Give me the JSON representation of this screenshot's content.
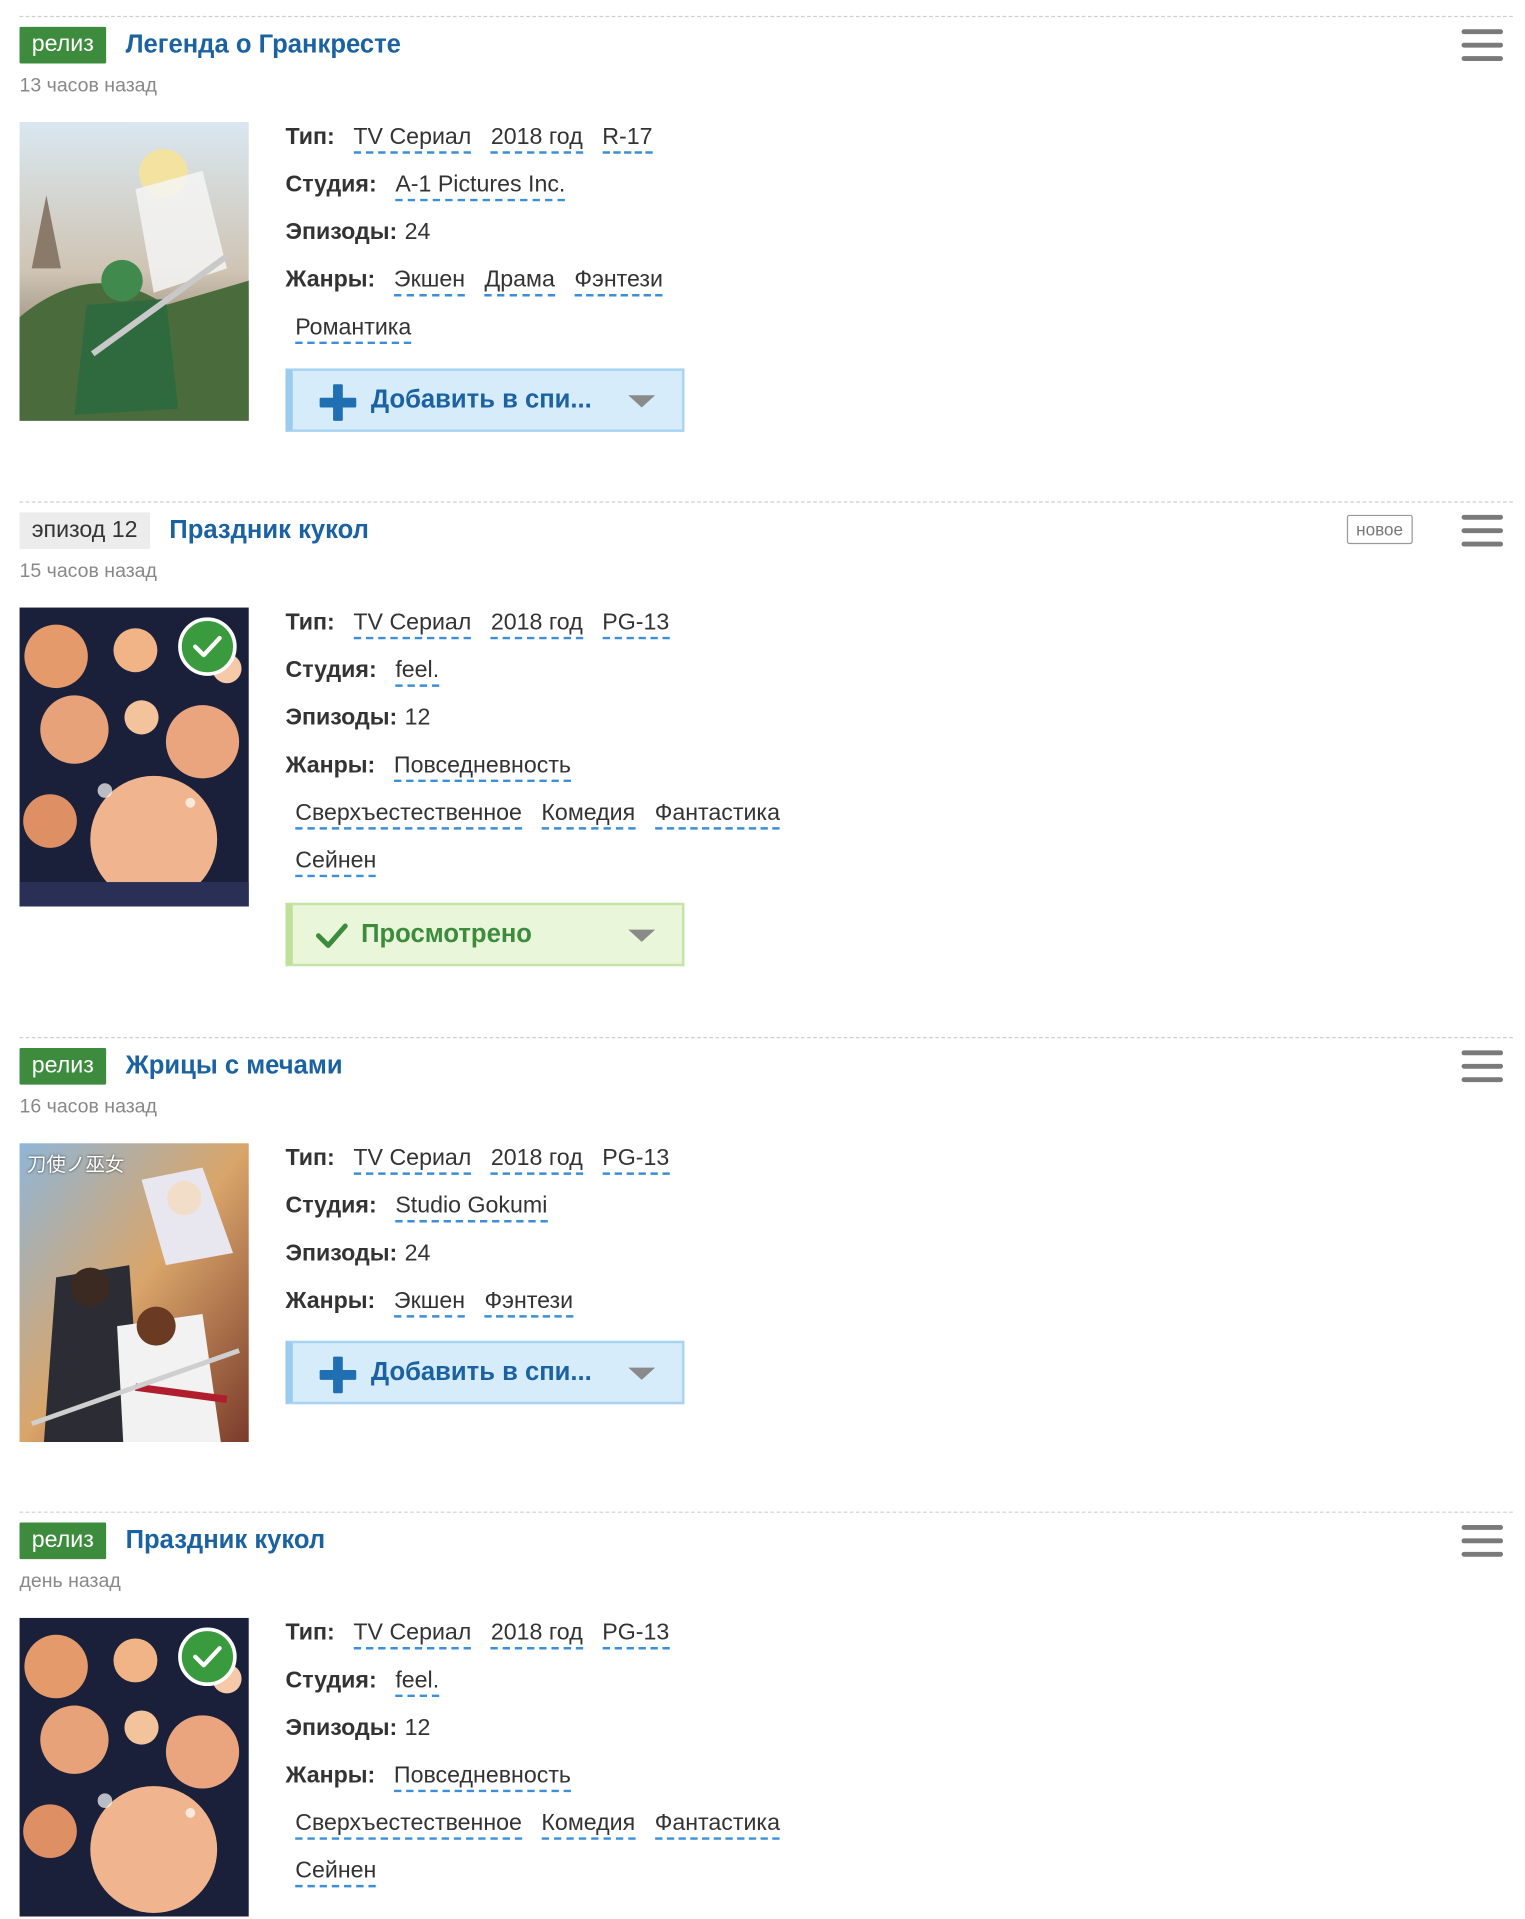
{
  "labels": {
    "type": "Тип:",
    "studio": "Студия:",
    "episodes": "Эпизоды:",
    "genres": "Жанры:"
  },
  "colors": {
    "release_badge": "#3d8b3d",
    "title_link": "#1b62a3",
    "dashed_underline": "#3b8fd8",
    "watched": "#3a9a3e"
  },
  "entries": [
    {
      "badge": "релиз",
      "title": "Легенда о Гранкресте",
      "time": "13 часов назад",
      "type": "TV Сериал",
      "year": "2018 год",
      "rating": "R-17",
      "studio": "A-1 Pictures Inc.",
      "episodes": "24",
      "genres_row1": [
        "Экшен",
        "Драма",
        "Фэнтези"
      ],
      "genres_row2": [
        "Романтика"
      ],
      "button": "Добавить в спи...",
      "button_icon": "plus-icon"
    },
    {
      "badge": "эпизод 12",
      "title": "Праздник кукол",
      "new_tag": "новое",
      "time": "15 часов назад",
      "type": "TV Сериал",
      "year": "2018 год",
      "rating": "PG-13",
      "studio": "feel.",
      "episodes": "12",
      "genres_row1": [
        "Повседневность"
      ],
      "genres_row2": [
        "Сверхъестественное",
        "Комедия",
        "Фантастика"
      ],
      "genres_row3": [
        "Сейнен"
      ],
      "button": "Просмотрено",
      "button_icon": "checkmark-icon"
    },
    {
      "badge": "релиз",
      "title": "Жрицы с мечами",
      "time": "16 часов назад",
      "poster_text": "刀使ノ巫女",
      "type": "TV Сериал",
      "year": "2018 год",
      "rating": "PG-13",
      "studio": "Studio Gokumi",
      "episodes": "24",
      "genres_row1": [
        "Экшен",
        "Фэнтези"
      ],
      "button": "Добавить в спи...",
      "button_icon": "plus-icon"
    },
    {
      "badge": "релиз",
      "title": "Праздник кукол",
      "time": "день назад",
      "type": "TV Сериал",
      "year": "2018 год",
      "rating": "PG-13",
      "studio": "feel.",
      "episodes": "12",
      "genres_row1": [
        "Повседневность"
      ],
      "genres_row2": [
        "Сверхъестественное",
        "Комедия",
        "Фантастика"
      ],
      "genres_row3": [
        "Сейнен"
      ]
    }
  ]
}
